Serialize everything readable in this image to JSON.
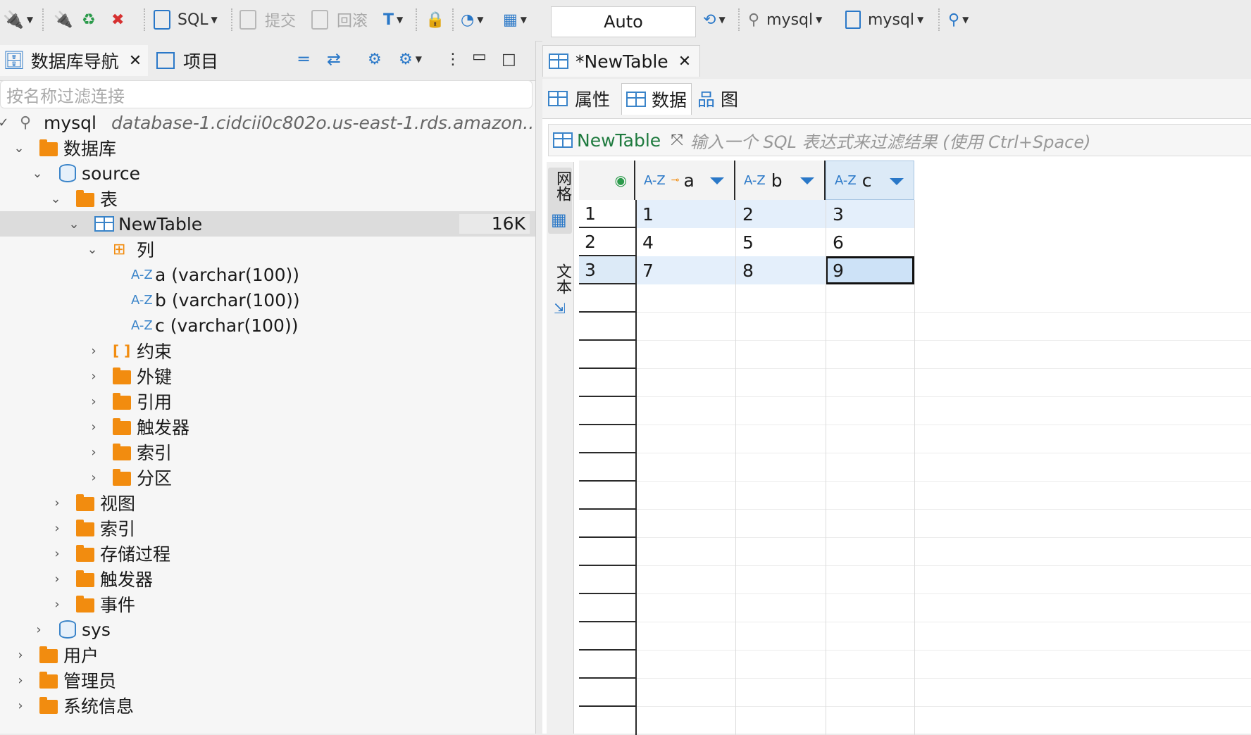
{
  "toolbar": {
    "sql_label": "SQL",
    "commit_label": "提交",
    "rollback_label": "回滚",
    "auto_commit": "Auto",
    "connection": "mysql",
    "database": "mysql"
  },
  "left": {
    "tabs": [
      {
        "label": "数据库导航"
      },
      {
        "label": "项目"
      }
    ],
    "filter_placeholder": "按名称过滤连接",
    "connection": {
      "name": "mysql",
      "host": "database-1.cidcii0c802o.us-east-1.rds.amazon..."
    },
    "tree": {
      "databases": "数据库",
      "schema_source": "source",
      "tables": "表",
      "table": {
        "name": "NewTable",
        "size": "16K"
      },
      "columns": "列",
      "cols": [
        "a (varchar(100))",
        "b (varchar(100))",
        "c (varchar(100))"
      ],
      "constraints": "约束",
      "foreign_keys": "外键",
      "references": "引用",
      "triggers": "触发器",
      "indexes": "索引",
      "partitions": "分区",
      "views": "视图",
      "db_indexes": "索引",
      "procedures": "存储过程",
      "db_triggers": "触发器",
      "events": "事件",
      "schema_sys": "sys",
      "users": "用户",
      "admins": "管理员",
      "sysinfo": "系统信息"
    }
  },
  "editor": {
    "tab_title": "*NewTable",
    "subtabs": [
      {
        "label": "属性"
      },
      {
        "label": "数据"
      },
      {
        "label": "图"
      }
    ],
    "filter_table": "NewTable",
    "filter_placeholder": "输入一个 SQL 表达式来过滤结果 (使用 Ctrl+Space)",
    "side_grid": "网格",
    "side_text": "文本",
    "columns": [
      "a",
      "b",
      "c"
    ],
    "az": "A-Z",
    "rows": [
      {
        "num": "1",
        "cells": [
          "1",
          "2",
          "3"
        ]
      },
      {
        "num": "2",
        "cells": [
          "4",
          "5",
          "6"
        ]
      },
      {
        "num": "3",
        "cells": [
          "7",
          "8",
          "9"
        ]
      }
    ]
  }
}
